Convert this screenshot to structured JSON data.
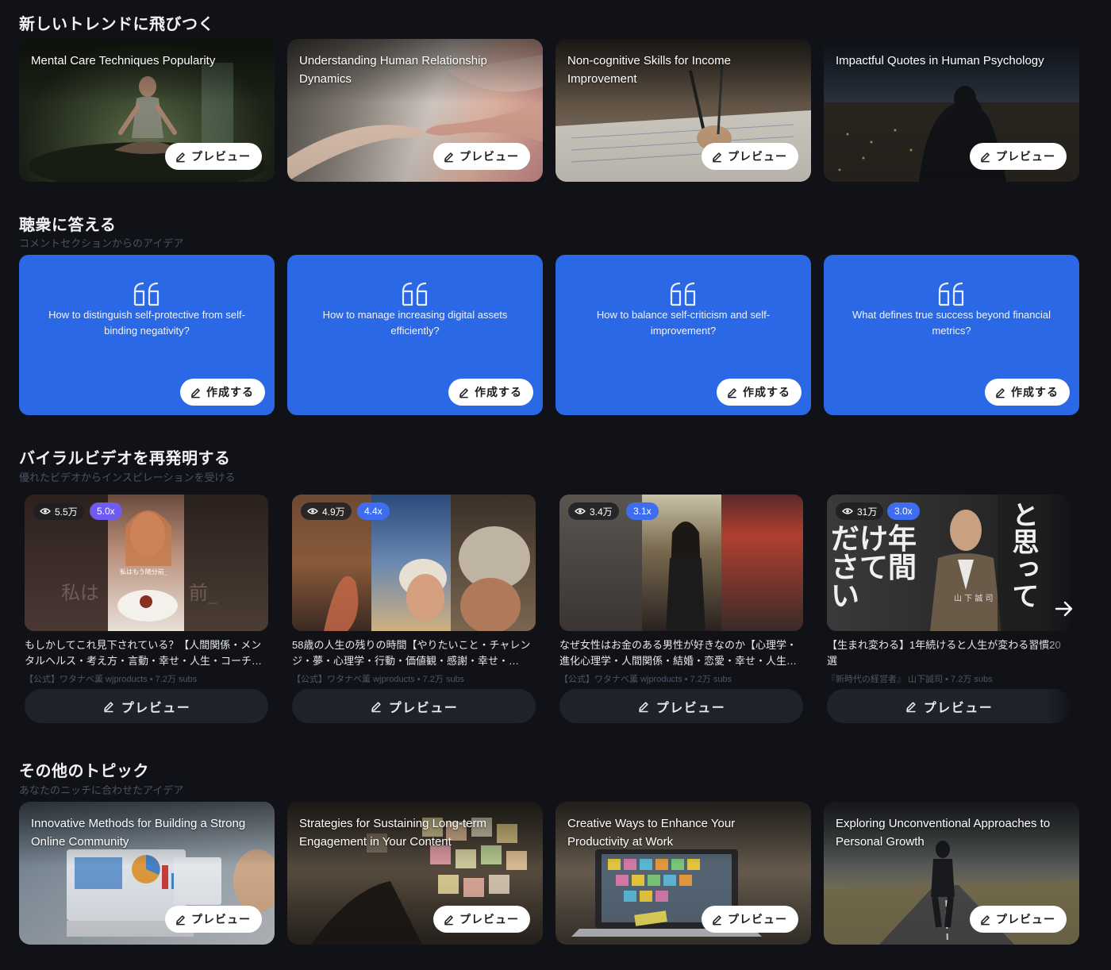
{
  "sections": {
    "trends": {
      "title": "新しいトレンドに飛びつく"
    },
    "answer": {
      "title": "聴衆に答える",
      "subtitle": "コメントセクションからのアイデア"
    },
    "viral": {
      "title": "バイラルビデオを再発明する",
      "subtitle": "優れたビデオからインスピレーションを受ける"
    },
    "other": {
      "title": "その他のトピック",
      "subtitle": "あなたのニッチに合わせたアイデア"
    }
  },
  "trend_cards": [
    {
      "title": "Mental Care Techniques Popularity",
      "button": "プレビュー"
    },
    {
      "title": "Understanding Human Relationship Dynamics",
      "button": "プレビュー"
    },
    {
      "title": "Non-cognitive Skills for Income Improvement",
      "button": "プレビュー"
    },
    {
      "title": "Impactful Quotes in Human Psychology",
      "button": "プレビュー"
    }
  ],
  "question_cards": [
    {
      "text": "How to distinguish self-protective from self-binding negativity?",
      "button": "作成する"
    },
    {
      "text": "How to manage increasing digital assets efficiently?",
      "button": "作成する"
    },
    {
      "text": "How to balance self-criticism and self-improvement?",
      "button": "作成する"
    },
    {
      "text": "What defines true success beyond financial metrics?",
      "button": "作成する"
    }
  ],
  "video_cards": [
    {
      "views": "5.5万",
      "multiplier": "5.0x",
      "title": "もしかしてこれ見下されている？【人間関係・メンタルヘルス・考え方・言動・幸せ・人生・コーチ…",
      "meta": "【公式】ワタナベ薫 wjproducts • 7.2万 subs",
      "button": "プレビュー",
      "thumb_text_left": "私は",
      "thumb_text_right": "前_",
      "thumb_caption": "私はもう随分前_"
    },
    {
      "views": "4.9万",
      "multiplier": "4.4x",
      "title": "58歳の人生の残りの時間【やりたいこと・チャレンジ・夢・心理学・行動・価値観・感謝・幸せ・…",
      "meta": "【公式】ワタナベ薫 wjproducts • 7.2万 subs",
      "button": "プレビュー"
    },
    {
      "views": "3.4万",
      "multiplier": "3.1x",
      "title": "なぜ女性はお金のある男性が好きなのか【心理学・進化心理学・人間関係・結婚・恋愛・幸せ・人生…",
      "meta": "【公式】ワタナベ薫 wjproducts • 7.2万 subs",
      "button": "プレビュー"
    },
    {
      "views": "31万",
      "multiplier": "3.0x",
      "title": "【生まれ変わる】1年続けると人生が変わる習慣20選",
      "meta": "『新時代の経営者』 山下誠司 • 7.2万 subs",
      "button": "プレビュー",
      "thumb_text_left": "だけ年さて間い",
      "thumb_text_right": "と思って",
      "thumb_caption": "山 下 誠 司"
    }
  ],
  "other_cards": [
    {
      "title": "Innovative Methods for Building a Strong Online Community",
      "button": "プレビュー"
    },
    {
      "title": "Strategies for Sustaining Long-term Engagement in Your Content",
      "button": "プレビュー"
    },
    {
      "title": "Creative Ways to Enhance Your Productivity at Work",
      "button": "プレビュー"
    },
    {
      "title": "Exploring Unconventional Approaches to Personal Growth",
      "button": "プレビュー"
    }
  ],
  "icons": {
    "edit": "edit-icon",
    "quote": "quote-icon",
    "eye": "eye-icon",
    "next": "arrow-right-icon"
  },
  "colors": {
    "background": "#101217",
    "question_card": "#2b68e6",
    "multiplier_badge": "#6e5cf0",
    "video_button": "#1f222b"
  }
}
